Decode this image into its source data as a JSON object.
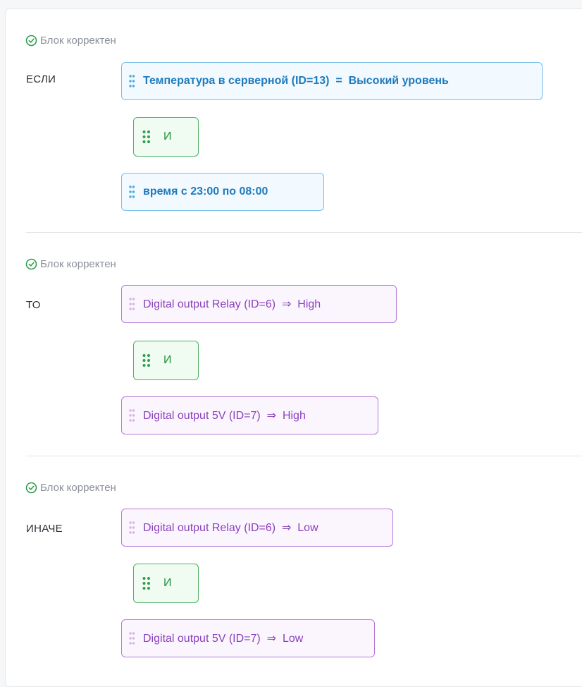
{
  "colors": {
    "status_ok": "#2f9e4f",
    "condition_accent": "#1f7bbd",
    "action_accent": "#8a40bd",
    "operator_accent": "#23903f"
  },
  "blocks": [
    {
      "status": "Блок корректен",
      "status_icon": "check-circle-icon",
      "keyword": "ЕСЛИ",
      "first": "Температура в серверной (ID=13)  =  Высокий уровень",
      "operator": "И",
      "second": "время с 23:00 по 08:00"
    },
    {
      "status": "Блок корректен",
      "status_icon": "check-circle-icon",
      "keyword": "ТО",
      "first": "Digital output Relay (ID=6)  ⇒  High",
      "operator": "И",
      "second": "Digital output 5V (ID=7)  ⇒  High"
    },
    {
      "status": "Блок корректен",
      "status_icon": "check-circle-icon",
      "keyword": "ИНАЧЕ",
      "first": "Digital output Relay (ID=6)  ⇒  Low",
      "operator": "И",
      "second": "Digital output 5V (ID=7)  ⇒  Low"
    }
  ]
}
